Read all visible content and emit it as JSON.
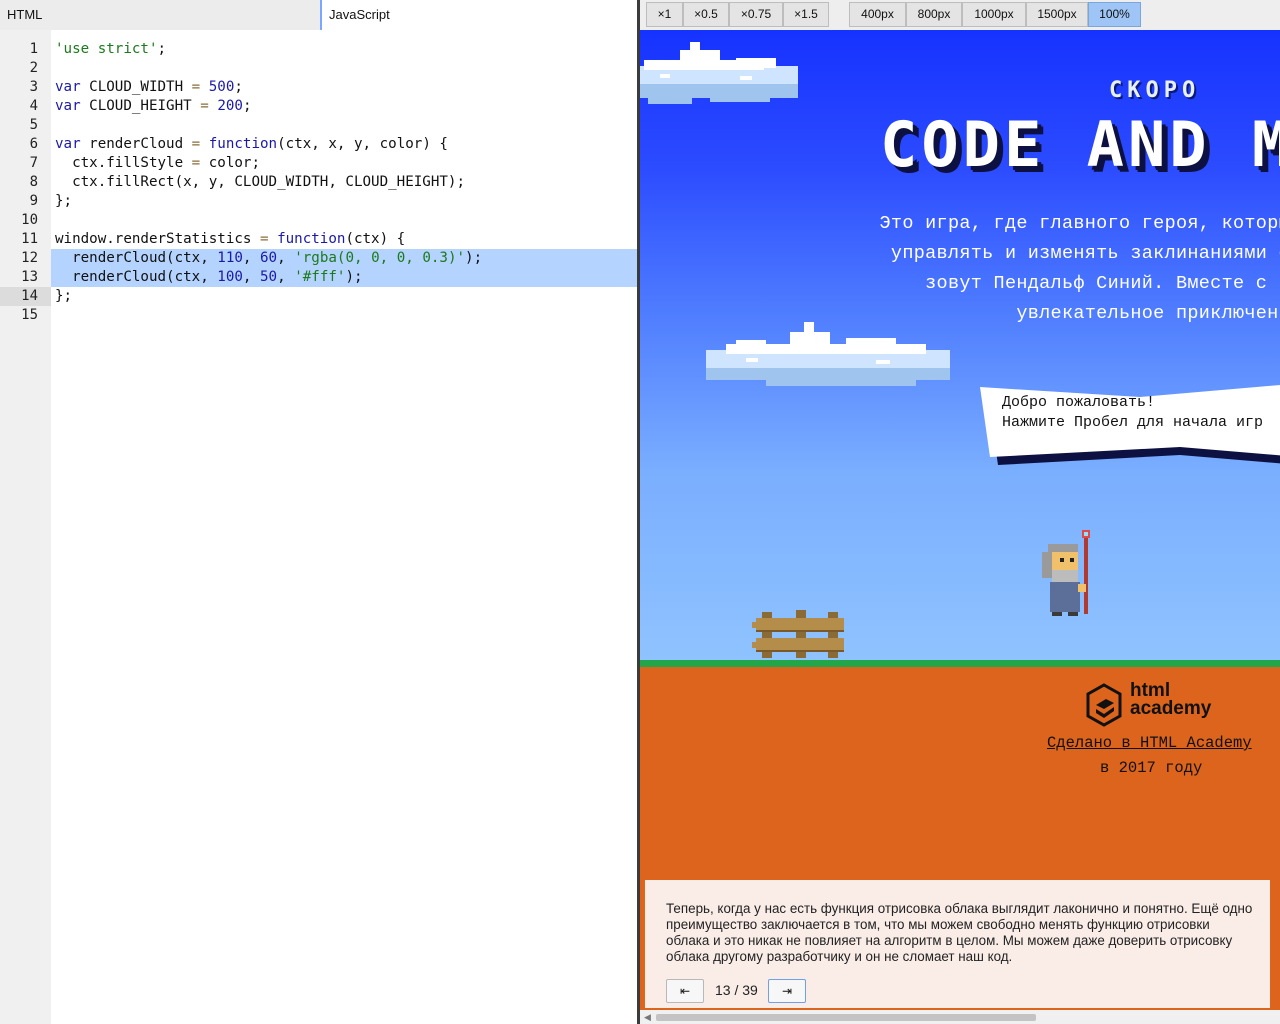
{
  "editor": {
    "tabs": [
      "HTML",
      "JavaScript"
    ],
    "active_line": "14",
    "lines": [
      {
        "n": "1",
        "code": "'use strict';"
      },
      {
        "n": "2",
        "code": ""
      },
      {
        "n": "3",
        "code": "var CLOUD_WIDTH = 500;"
      },
      {
        "n": "4",
        "code": "var CLOUD_HEIGHT = 200;"
      },
      {
        "n": "5",
        "code": ""
      },
      {
        "n": "6",
        "code": "var renderCloud = function(ctx, x, y, color) {"
      },
      {
        "n": "7",
        "code": "  ctx.fillStyle = color;"
      },
      {
        "n": "8",
        "code": "  ctx.fillRect(x, y, CLOUD_WIDTH, CLOUD_HEIGHT);"
      },
      {
        "n": "9",
        "code": "};"
      },
      {
        "n": "10",
        "code": ""
      },
      {
        "n": "11",
        "code": "window.renderStatistics = function(ctx) {"
      },
      {
        "n": "12",
        "code": "  renderCloud(ctx, 110, 60, 'rgba(0, 0, 0, 0.3)');"
      },
      {
        "n": "13",
        "code": "  renderCloud(ctx, 100, 50, '#fff');"
      },
      {
        "n": "14",
        "code": "};"
      },
      {
        "n": "15",
        "code": ""
      }
    ],
    "selected_lines": [
      "12",
      "13"
    ]
  },
  "toolbar": {
    "scale_buttons": [
      "×1",
      "×0.5",
      "×0.75",
      "×1.5"
    ],
    "width_buttons": [
      "400px",
      "800px",
      "1000px",
      "1500px",
      "100%"
    ],
    "active_width": "100%"
  },
  "page": {
    "soon": "СКОРО",
    "title": "CODE AND MA",
    "description_lines": [
      "Это игра, где главного героя, которы",
      "управлять и изменять заклинаниями с",
      "зовут Пендальф Синий. Вместе с н",
      "увлекательное приключени"
    ],
    "bubble_lines": [
      "Добро пожаловать!",
      "Нажмите Пробел для начала игр"
    ],
    "academy_name": "html\nacademy",
    "academy_name_line1": "html",
    "academy_name_line2": "academy",
    "made_in": "Сделано в HTML Academy",
    "year": "в 2017 году"
  },
  "lesson": {
    "text": "Теперь, когда у нас есть функция отрисовка облака выглядит лаконично и понятно. Ещё одно преимущество заключается в том, что мы можем свободно менять функцию отрисовки облака и это никак не повлияет на алгоритм в целом. Мы можем даже доверить отрисовку облака другому разработчику и он не сломает наш код.",
    "prev_label": "⇤",
    "next_label": "⇥",
    "page_count": "13 / 39"
  },
  "colors": {
    "sky_top": "#1632ff",
    "sky_bottom": "#8fc3ff",
    "ground": "#dc641d",
    "grass": "#23a64a",
    "selection": "#b4d3ff",
    "active_toolbar": "#9ec5f6"
  }
}
